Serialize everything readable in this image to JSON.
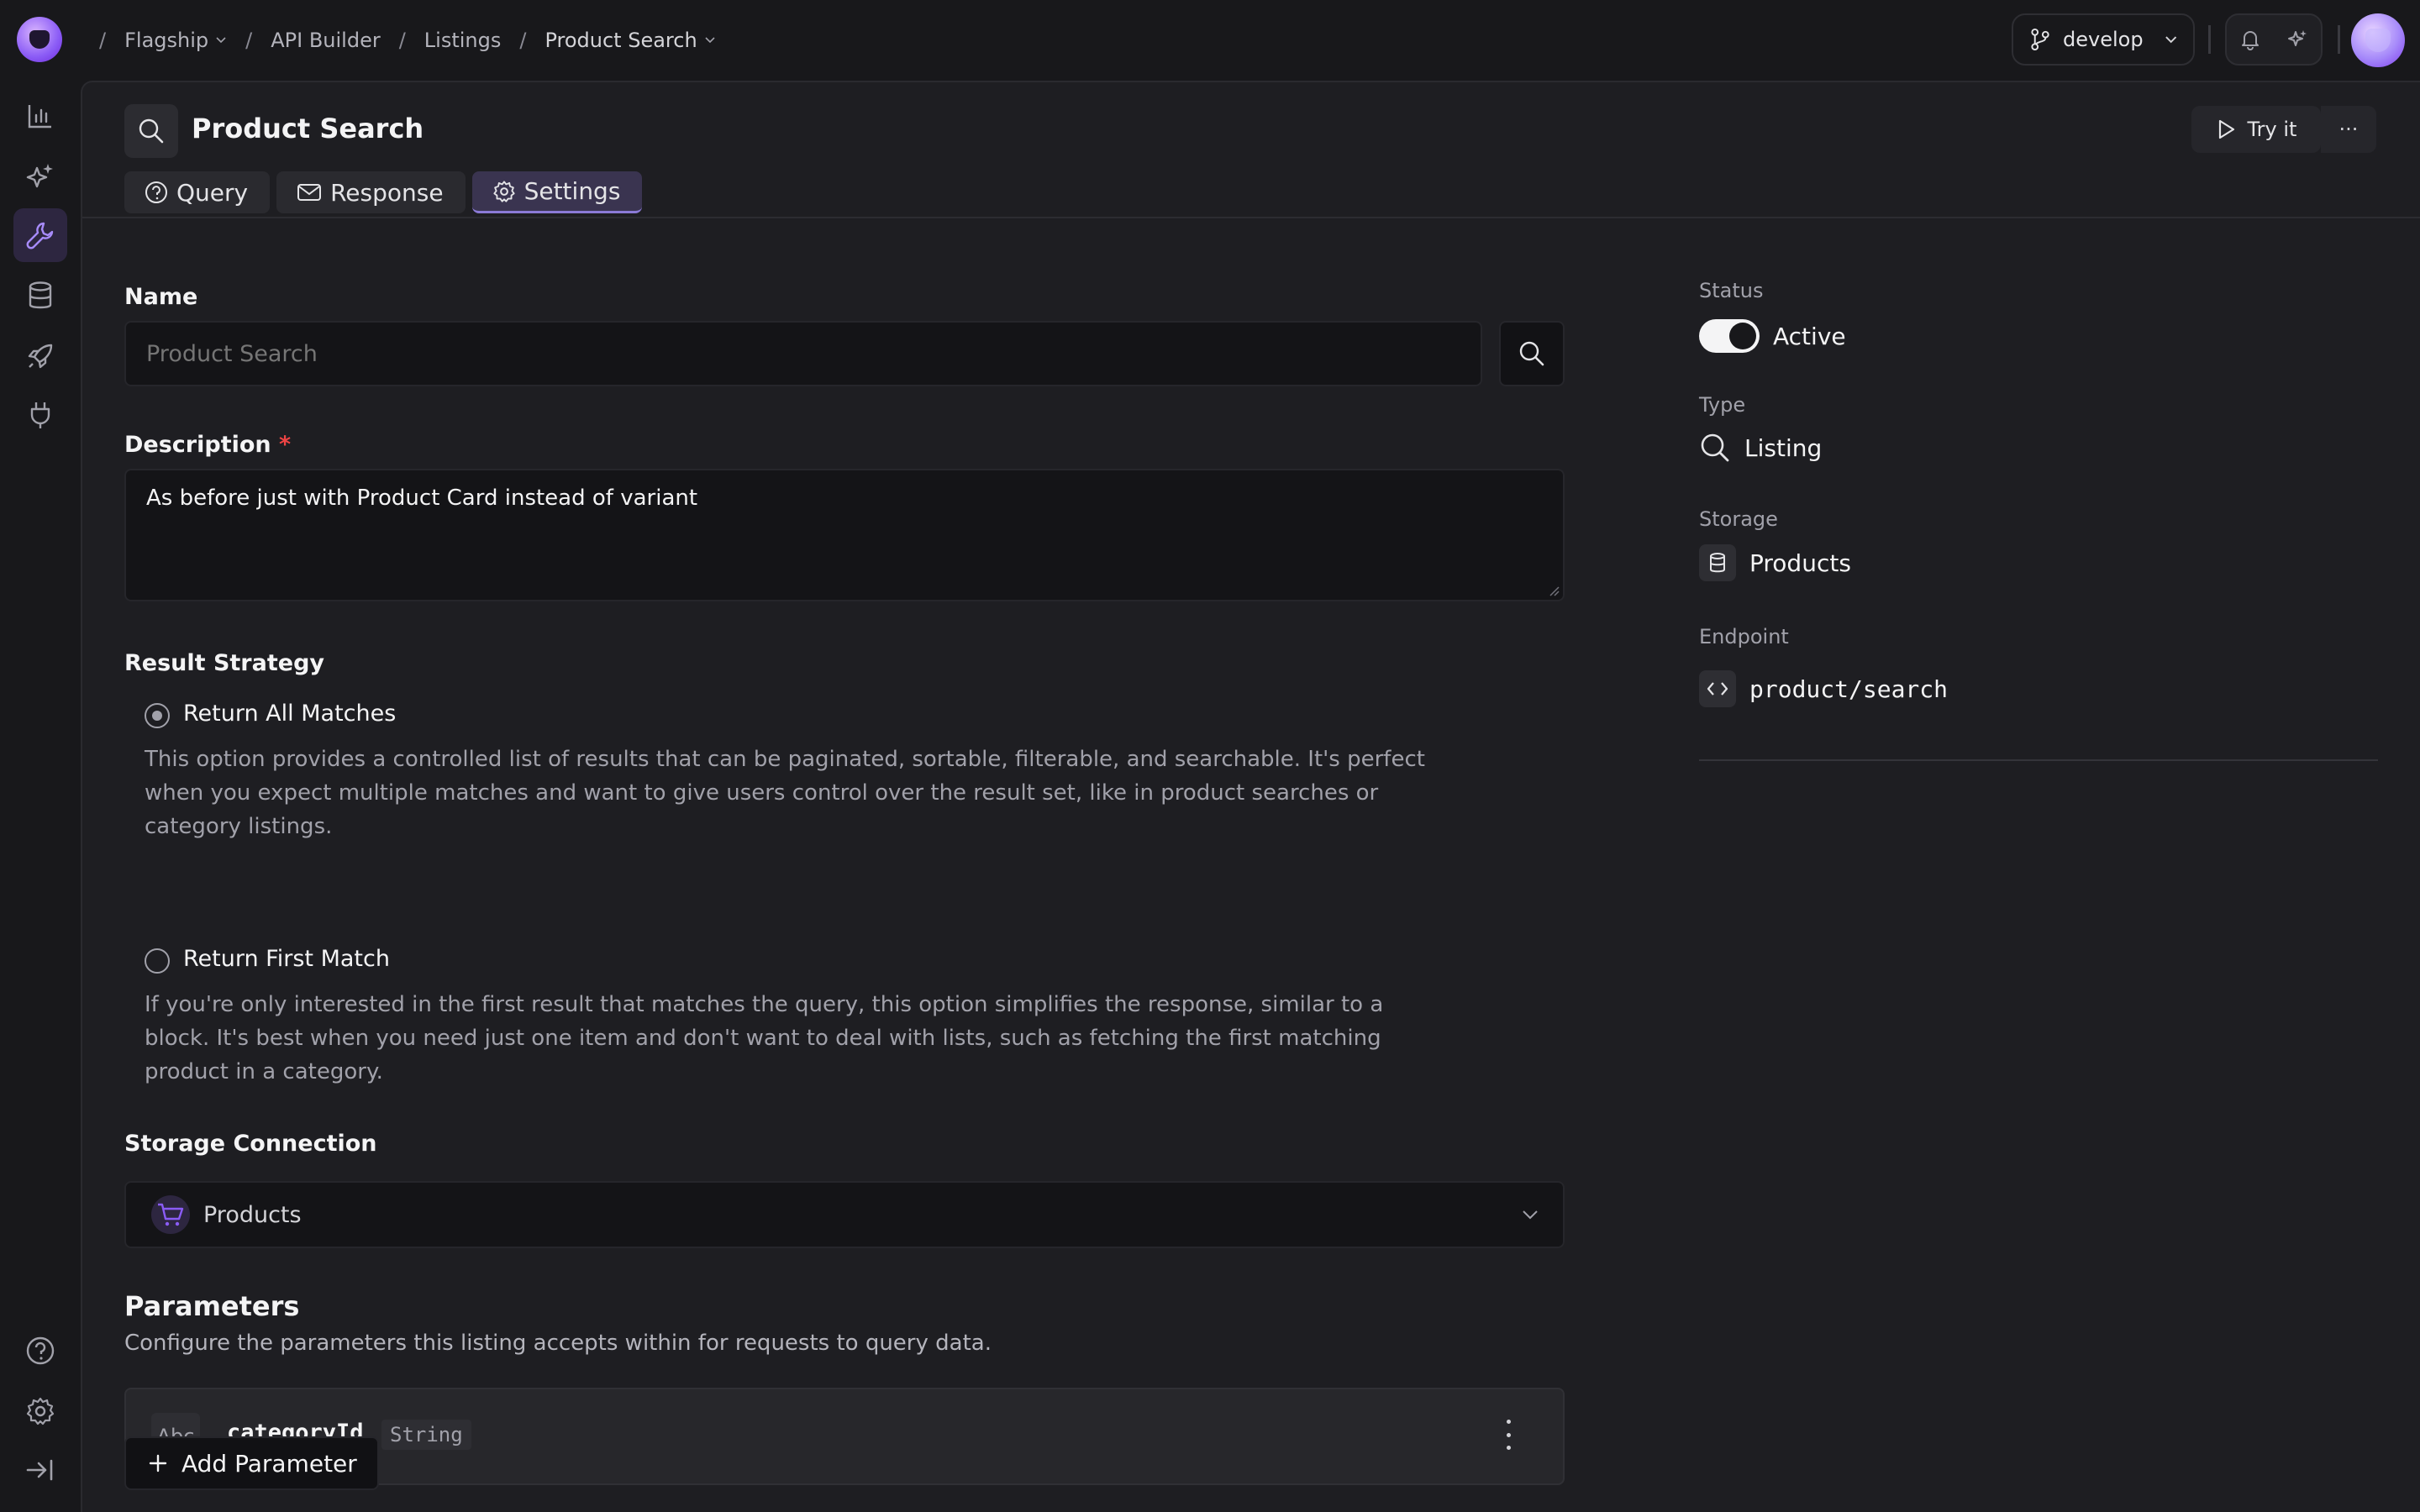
{
  "breadcrumb": {
    "items": [
      {
        "label": "Flagship",
        "has_menu": true
      },
      {
        "label": "API Builder",
        "has_menu": false
      },
      {
        "label": "Listings",
        "has_menu": false
      },
      {
        "label": "Product Search",
        "has_menu": true
      }
    ]
  },
  "branch": {
    "label": "develop"
  },
  "sidebar": {
    "items": [
      {
        "icon": "chart-bar-icon"
      },
      {
        "icon": "sparkles-icon"
      },
      {
        "icon": "wrench-icon",
        "active": true
      },
      {
        "icon": "database-icon"
      },
      {
        "icon": "rocket-icon"
      },
      {
        "icon": "plug-icon"
      }
    ],
    "bottom": [
      {
        "icon": "help-circle-icon"
      },
      {
        "icon": "gear-icon"
      },
      {
        "icon": "collapse-sidebar-icon"
      }
    ]
  },
  "header": {
    "title": "Product Search",
    "try_label": "Try it",
    "more_label": "···",
    "tabs": [
      {
        "label": "Query",
        "icon": "question-circle-icon"
      },
      {
        "label": "Response",
        "icon": "envelope-icon"
      },
      {
        "label": "Settings",
        "icon": "gear-icon",
        "active": true
      }
    ]
  },
  "form": {
    "name_label": "Name",
    "name_placeholder": "Product Search",
    "description_label": "Description",
    "description_required": "*",
    "description_value": "As before just with Product Card instead of variant",
    "strategy_label": "Result Strategy",
    "strategies": [
      {
        "label": "Return All Matches",
        "selected": true,
        "description": "This option provides a controlled list of results that can be paginated, sortable, filterable, and searchable. It's perfect when you expect multiple matches and want to give users control over the result set, like in product searches or category listings."
      },
      {
        "label": "Return First Match",
        "selected": false,
        "description": "If you're only interested in the first result that matches the query, this option simplifies the response, similar to a block. It's best when you need just one item and don't want to deal with lists, such as fetching the first matching product in a category."
      }
    ],
    "storage_label": "Storage Connection",
    "storage_value": "Products"
  },
  "parameters": {
    "title": "Parameters",
    "subtitle": "Configure the parameters this listing accepts within for requests to query data.",
    "items": [
      {
        "type_icon_label": "Abc",
        "name": "categoryId",
        "type": "String"
      }
    ],
    "add_label": "Add Parameter"
  },
  "details": {
    "status_label": "Status",
    "status_value": "Active",
    "status_on": true,
    "type_label": "Type",
    "type_value": "Listing",
    "storage_label": "Storage",
    "storage_value": "Products",
    "endpoint_label": "Endpoint",
    "endpoint_value": "product/search"
  },
  "colors": {
    "background": "#18181b",
    "panel": "#1e1e22",
    "accent": "#8b5cf6",
    "active_tab": "#3a3450",
    "required": "#ef4444"
  }
}
